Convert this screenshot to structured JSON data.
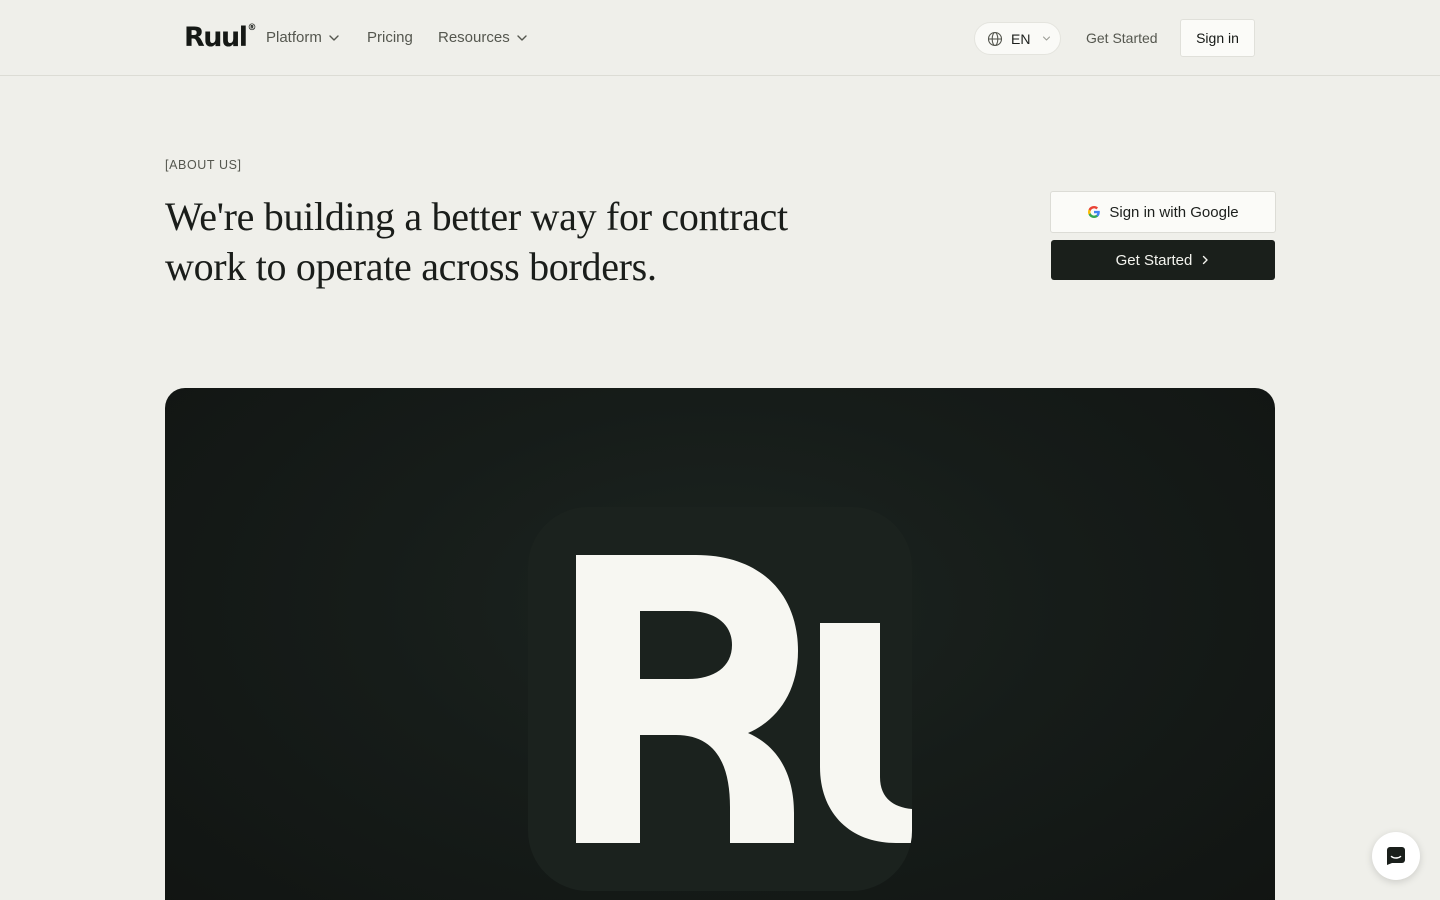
{
  "brand": {
    "logo_text": "Ruul",
    "logo_mark": "®"
  },
  "nav": {
    "platform": "Platform",
    "pricing": "Pricing",
    "resources": "Resources",
    "language": "EN",
    "get_started": "Get Started",
    "sign_in": "Sign in"
  },
  "hero": {
    "eyebrow": "[ABOUT US]",
    "headline_line1": "We're building a better way for contract",
    "headline_line2": "work to operate across borders.",
    "google_button": "Sign in with Google",
    "cta_button": "Get Started"
  },
  "colors": {
    "page_bg": "#efefea",
    "dark": "#1a1f1b",
    "panel": "#161c19",
    "tile_letter": "#f7f7f2"
  },
  "icons": {
    "language": "globe-icon",
    "dropdown": "chevron-down-icon",
    "google": "google-icon",
    "cta": "chevron-right-icon",
    "chat": "chat-icon"
  }
}
